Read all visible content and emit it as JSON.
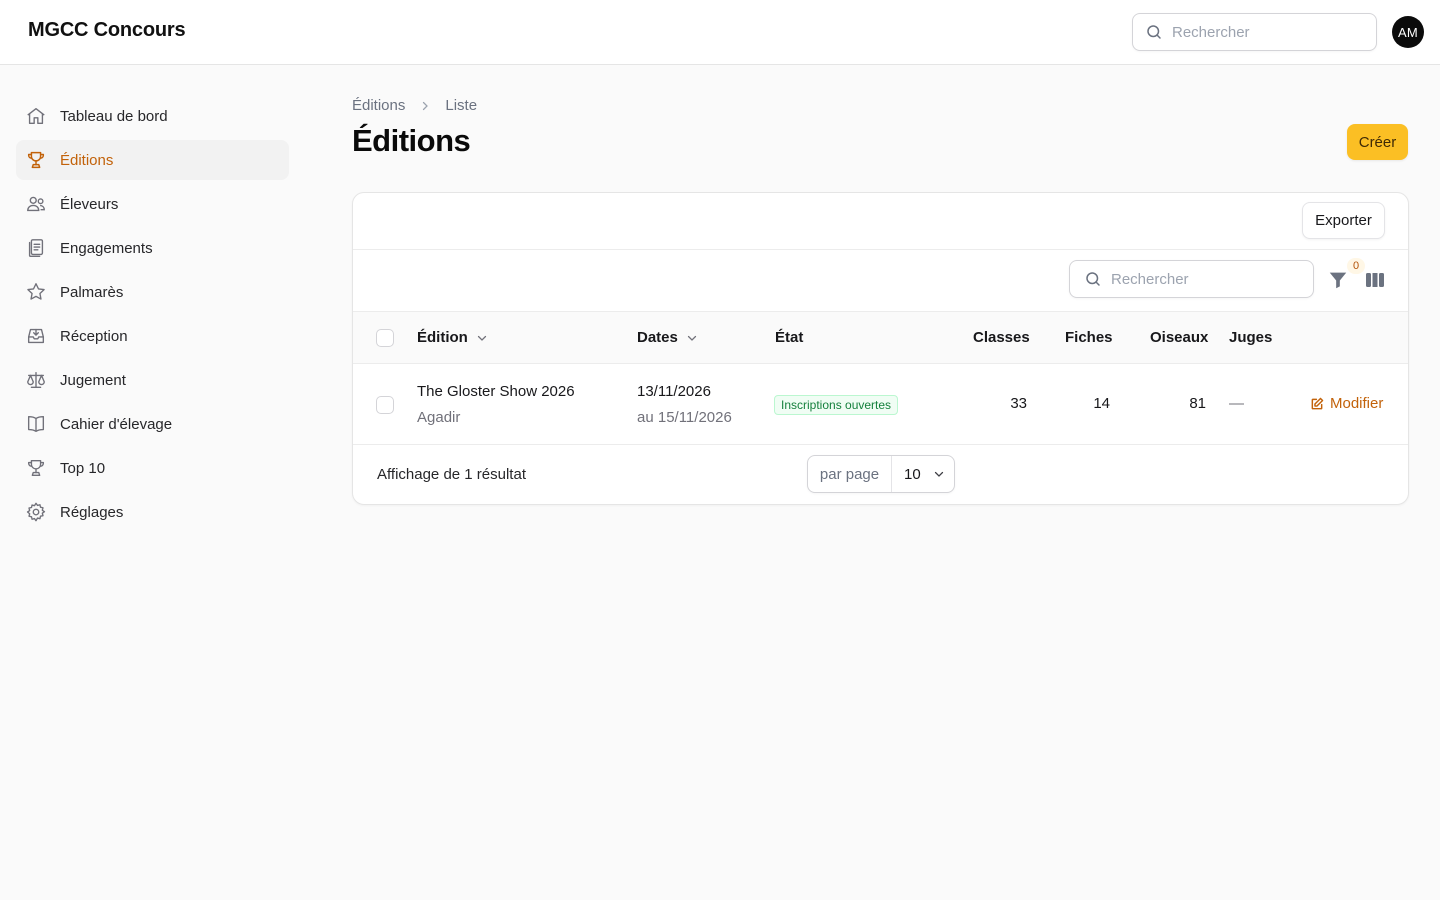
{
  "app": {
    "brand": "MGCC Concours",
    "search_placeholder": "Rechercher",
    "user_initials": "AM"
  },
  "sidebar": {
    "items": [
      {
        "label": "Tableau de bord",
        "icon": "home-icon",
        "active": false
      },
      {
        "label": "Éditions",
        "icon": "trophy-icon",
        "active": true
      },
      {
        "label": "Éleveurs",
        "icon": "users-icon",
        "active": false
      },
      {
        "label": "Engagements",
        "icon": "clipboard-list-icon",
        "active": false
      },
      {
        "label": "Palmarès",
        "icon": "star-icon",
        "active": false
      },
      {
        "label": "Réception",
        "icon": "inbox-icon",
        "active": false
      },
      {
        "label": "Jugement",
        "icon": "scale-icon",
        "active": false
      },
      {
        "label": "Cahier d'élevage",
        "icon": "book-icon",
        "active": false
      },
      {
        "label": "Top 10",
        "icon": "trophy-icon",
        "active": false
      },
      {
        "label": "Réglages",
        "icon": "gear-icon",
        "active": false
      }
    ]
  },
  "breadcrumb": {
    "parent": "Éditions",
    "current": "Liste"
  },
  "page": {
    "title": "Éditions",
    "create_label": "Créer"
  },
  "table": {
    "export_label": "Exporter",
    "search_placeholder": "Rechercher",
    "filter_count": "0",
    "columns": {
      "edition": "Édition",
      "dates": "Dates",
      "state": "État",
      "classes": "Classes",
      "fiches": "Fiches",
      "oiseaux": "Oiseaux",
      "juges": "Juges"
    },
    "rows": [
      {
        "name": "The Gloster Show 2026",
        "location": "Agadir",
        "date_start": "13/11/2026",
        "date_end": "au 15/11/2026",
        "state": "Inscriptions ouvertes",
        "classes": "33",
        "fiches": "14",
        "oiseaux": "81",
        "juges": "—",
        "action": "Modifier"
      }
    ],
    "footer": {
      "result_text": "Affichage de 1 résultat",
      "per_page_label": "par page",
      "per_page_value": "10"
    }
  },
  "colors": {
    "accent": "#c2620a",
    "primary_button": "#fbbf24",
    "badge_green": "#15803d"
  }
}
